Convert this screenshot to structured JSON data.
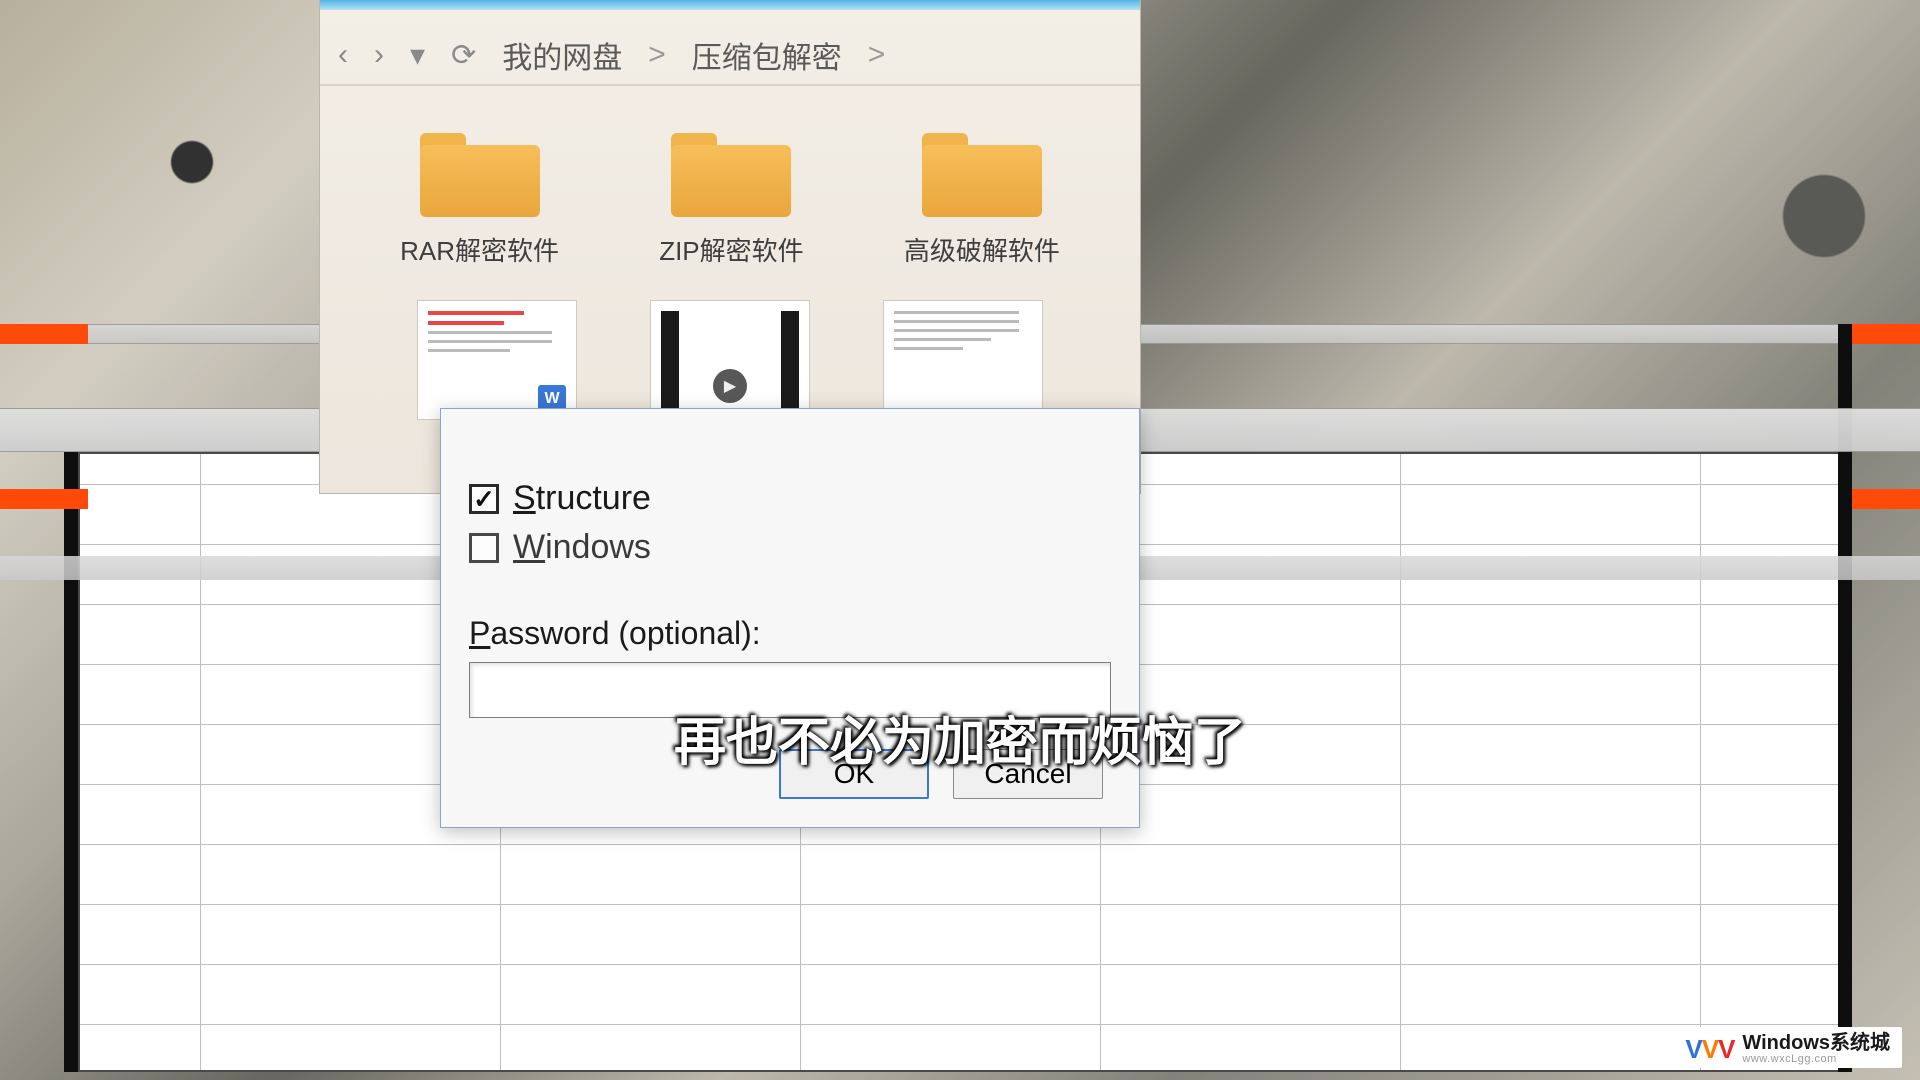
{
  "cloud": {
    "breadcrumb": {
      "root": "我的网盘",
      "sep": ">",
      "current": "压缩包解密"
    },
    "folders": [
      {
        "label": "RAR解密软件"
      },
      {
        "label": "ZIP解密软件"
      },
      {
        "label": "高级破解软件"
      }
    ],
    "word_badge": "W"
  },
  "dialog": {
    "structure_label_pre": "S",
    "structure_label_rest": "tructure",
    "windows_label_pre": "W",
    "windows_label_rest": "indows",
    "password_label_pre": "P",
    "password_label_rest": "assword (optional):",
    "password_value": "",
    "ok_label": "OK",
    "cancel_label": "Cancel"
  },
  "subtitle": "再也不必为加密而烦恼了",
  "watermark": {
    "title": "Windows系统城",
    "url": "www.wxcLgg.com"
  }
}
